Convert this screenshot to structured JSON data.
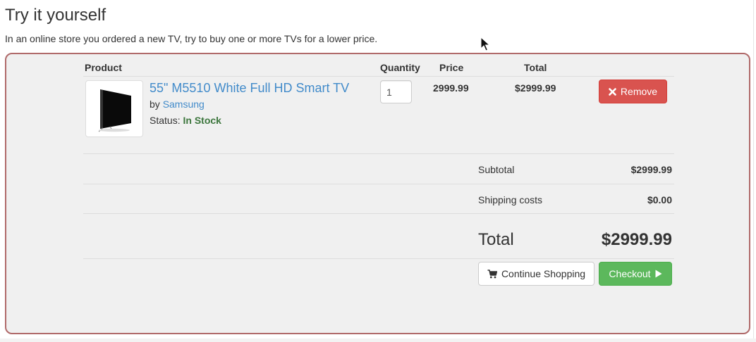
{
  "heading": "Try it yourself",
  "intro": "In an online store you ordered a new TV, try to buy one or more TVs for a lower price.",
  "table": {
    "headers": {
      "product": "Product",
      "quantity": "Quantity",
      "price": "Price",
      "total": "Total"
    }
  },
  "item": {
    "image_icon": "tv-icon",
    "name": "55\" M5510 White Full HD Smart TV",
    "by_prefix": "by",
    "brand": "Samsung",
    "status_prefix": "Status:",
    "status": "In Stock",
    "quantity": "1",
    "price": "2999.99",
    "total": "$2999.99",
    "remove_label": "Remove",
    "remove_icon": "times-icon"
  },
  "summary": {
    "subtotal_label": "Subtotal",
    "subtotal_value": "$2999.99",
    "shipping_label": "Shipping costs",
    "shipping_value": "$0.00",
    "total_label": "Total",
    "total_value": "$2999.99"
  },
  "actions": {
    "continue_label": "Continue Shopping",
    "continue_icon": "shopping-cart-icon",
    "checkout_label": "Checkout",
    "checkout_icon": "play-icon"
  },
  "colors": {
    "link": "#428bca",
    "danger": "#d9534f",
    "success": "#5cb85c",
    "in_stock": "#3c763d",
    "box_border": "#b06a6a",
    "box_background": "#f0f0f0"
  }
}
